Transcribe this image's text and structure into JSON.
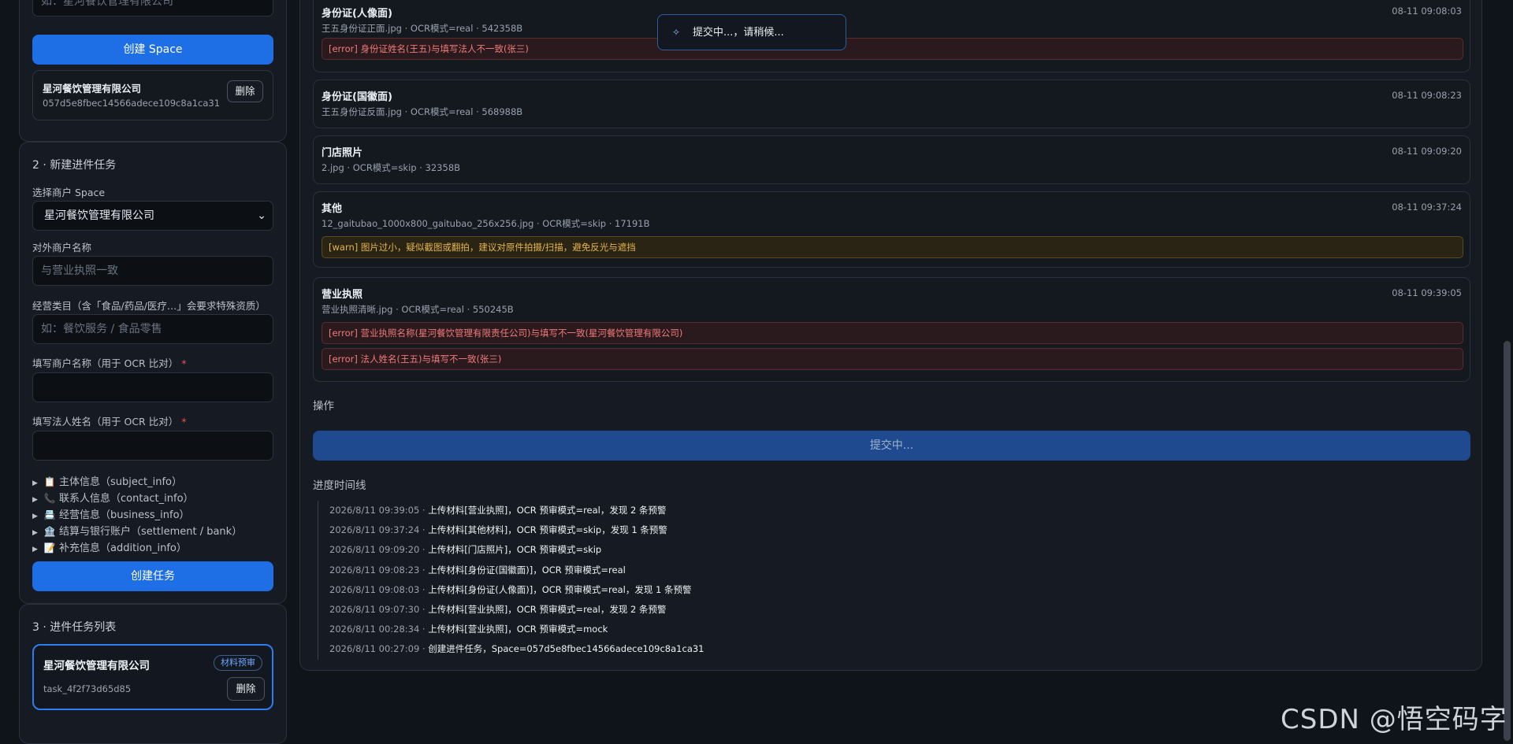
{
  "space_card": {
    "merchant_placeholder": "如：星河餐饮管理有限公司",
    "create_space_label": "创建 Space",
    "space": {
      "name": "星河餐饮管理有限公司",
      "id": "057d5e8fbec14566adece109c8a1ca31",
      "delete_label": "删除"
    }
  },
  "task_form": {
    "title": "2 · 新建进件任务",
    "select_label": "选择商户 Space",
    "select_value": "星河餐饮管理有限公司",
    "external_name_label": "对外商户名称",
    "external_name_placeholder": "与营业执照一致",
    "category_label": "经营类目（含「食品/药品/医疗…」会要求特殊资质）",
    "category_placeholder": "如：餐饮服务 / 食品零售",
    "merchant_name_label": "填写商户名称（用于 OCR 比对）",
    "legal_name_label": "填写法人姓名（用于 OCR 比对）",
    "required_mark": "*",
    "sections": [
      {
        "icon": "📋",
        "label": "主体信息（subject_info）"
      },
      {
        "icon": "📞",
        "label": "联系人信息（contact_info）"
      },
      {
        "icon": "📇",
        "label": "经营信息（business_info）"
      },
      {
        "icon": "🏦",
        "label": "结算与银行账户（settlement / bank）"
      },
      {
        "icon": "📝",
        "label": "补充信息（addition_info）"
      }
    ],
    "create_task_label": "创建任务"
  },
  "task_list": {
    "title": "3 · 进件任务列表",
    "task": {
      "name": "星河餐饮管理有限公司",
      "badge": "材料预审",
      "id": "task_4f2f73d65d85",
      "delete_label": "删除"
    }
  },
  "files": [
    {
      "title": "身份证(人像面)",
      "meta": "王五身份证正面.jpg · OCR模式=real · 542358B",
      "time": "08-11 09:08:03",
      "alerts": [
        {
          "level": "err",
          "text": "[error] 身份证姓名(王五)与填写法人不一致(张三)"
        }
      ]
    },
    {
      "title": "身份证(国徽面)",
      "meta": "王五身份证反面.jpg · OCR模式=real · 568988B",
      "time": "08-11 09:08:23",
      "alerts": []
    },
    {
      "title": "门店照片",
      "meta": "2.jpg · OCR模式=skip · 32358B",
      "time": "08-11 09:09:20",
      "alerts": []
    },
    {
      "title": "其他",
      "meta": "12_gaitubao_1000x800_gaitubao_256x256.jpg · OCR模式=skip · 17191B",
      "time": "08-11 09:37:24",
      "alerts": [
        {
          "level": "warn",
          "text": "[warn] 图片过小，疑似截图或翻拍，建议对原件拍摄/扫描，避免反光与遮挡"
        }
      ]
    },
    {
      "title": "营业执照",
      "meta": "营业执照清晰.jpg · OCR模式=real · 550245B",
      "time": "08-11 09:39:05",
      "alerts": [
        {
          "level": "err",
          "text": "[error] 营业执照名称(星河餐饮管理有限责任公司)与填写不一致(星河餐饮管理有限公司)"
        },
        {
          "level": "err",
          "text": "[error] 法人姓名(王五)与填写不一致(张三)"
        }
      ]
    }
  ],
  "operations": {
    "label": "操作",
    "submit_label": "提交中..."
  },
  "timeline": {
    "label": "进度时间线",
    "entries": [
      {
        "time": "2026/8/11 09:39:05",
        "text": "上传材料[营业执照]，OCR 预审模式=real，发现 2 条预警"
      },
      {
        "time": "2026/8/11 09:37:24",
        "text": "上传材料[其他材料]，OCR 预审模式=skip，发现 1 条预警"
      },
      {
        "time": "2026/8/11 09:09:20",
        "text": "上传材料[门店照片]，OCR 预审模式=skip"
      },
      {
        "time": "2026/8/11 09:08:23",
        "text": "上传材料[身份证(国徽面)]，OCR 预审模式=real"
      },
      {
        "time": "2026/8/11 09:08:03",
        "text": "上传材料[身份证(人像面)]，OCR 预审模式=real，发现 1 条预警"
      },
      {
        "time": "2026/8/11 09:07:30",
        "text": "上传材料[营业执照]，OCR 预审模式=real，发现 2 条预警"
      },
      {
        "time": "2026/8/11 00:28:34",
        "text": "上传材料[营业执照]，OCR 预审模式=mock"
      },
      {
        "time": "2026/8/11 00:27:09",
        "text": "创建进件任务，Space=057d5e8fbec14566adece109c8a1ca31"
      }
    ]
  },
  "toast": {
    "text": "提交中...，请稍候..."
  },
  "watermark": "CSDN @悟空码字"
}
